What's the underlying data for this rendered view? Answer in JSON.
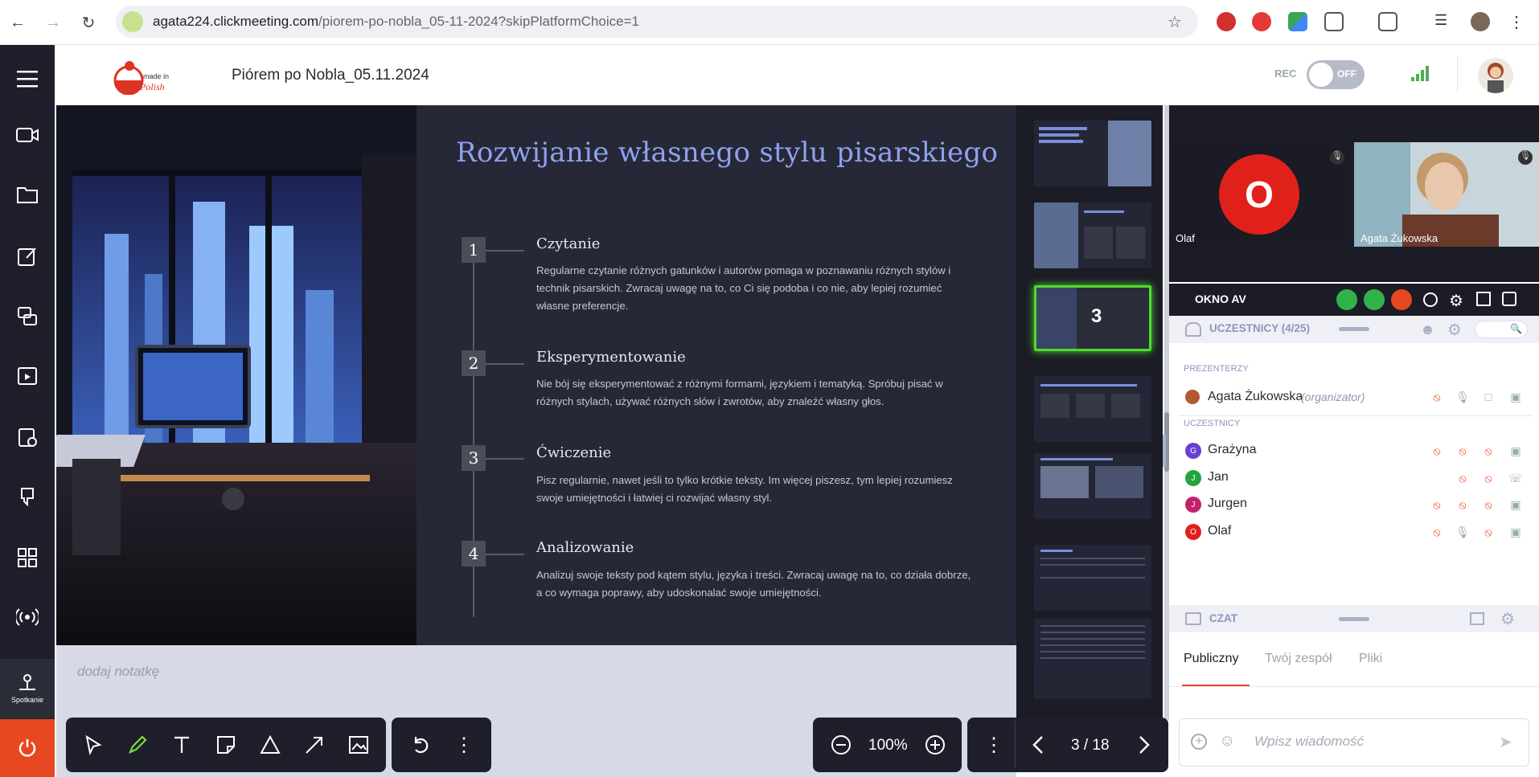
{
  "browser": {
    "url_domain": "agata224.clickmeeting.com",
    "url_path": "/piorem-po-nobla_05-11-2024?skipPlatformChoice=1"
  },
  "header": {
    "logo_text_top": "made in",
    "logo_text_bottom": "Polish",
    "title": "Piórem po Nobla_05.11.2024",
    "rec_label": "REC",
    "rec_toggle": "OFF"
  },
  "sidebar": {
    "meeting_label": "Spotkanie"
  },
  "slide": {
    "title": "Rozwijanie własnego stylu pisarskiego",
    "items": [
      {
        "num": "1",
        "title": "Czytanie",
        "text": "Regularne czytanie różnych gatunków i autorów pomaga w poznawaniu różnych stylów i technik pisarskich. Zwracaj uwagę na to, co Ci się podoba i co nie, aby lepiej rozumieć własne preferencje."
      },
      {
        "num": "2",
        "title": "Eksperymentowanie",
        "text": "Nie bój się eksperymentować z różnymi formami, językiem i tematyką. Spróbuj pisać w różnych stylach, używać różnych słów i zwrotów, aby znaleźć własny głos."
      },
      {
        "num": "3",
        "title": "Ćwiczenie",
        "text": "Pisz regularnie, nawet jeśli to tylko krótkie teksty. Im więcej piszesz, tym lepiej rozumiesz swoje umiejętności i łatwiej ci rozwijać własny styl."
      },
      {
        "num": "4",
        "title": "Analizowanie",
        "text": "Analizuj swoje teksty pod kątem stylu, języka i treści. Zwracaj uwagę na to, co działa dobrze, a co wymaga poprawy, aby udoskonalać swoje umiejętności."
      }
    ]
  },
  "notes": {
    "placeholder": "dodaj notatkę"
  },
  "thumbnails": {
    "active_label": "3"
  },
  "toolbar": {
    "zoom": "100%",
    "page": "3 / 18"
  },
  "video": {
    "tiles": [
      {
        "initial": "O",
        "name": "Olaf"
      },
      {
        "name": "Agata Żukowska"
      }
    ],
    "window_label": "OKNO AV"
  },
  "participants": {
    "header": "UCZESTNICY (4/25)",
    "presenters_label": "PREZENTERZY",
    "presenter": {
      "name": "Agata Żukowska",
      "role": "(organizator)"
    },
    "attendees_label": "UCZESTNICY",
    "attendees": [
      {
        "initial": "G",
        "name": "Grażyna",
        "color": "#6a3fd6"
      },
      {
        "initial": "J",
        "name": "Jan",
        "color": "#25a33d"
      },
      {
        "initial": "J",
        "name": "Jurgen",
        "color": "#c2216c"
      },
      {
        "initial": "O",
        "name": "Olaf",
        "color": "#e0211b"
      }
    ]
  },
  "chat": {
    "header": "CZAT",
    "tabs": [
      "Publiczny",
      "Twój zespół",
      "Pliki"
    ],
    "placeholder": "Wpisz wiadomość"
  },
  "colors": {
    "accent": "#e8481f",
    "active_green": "#4fdb2c",
    "slide_bg": "#262837"
  }
}
